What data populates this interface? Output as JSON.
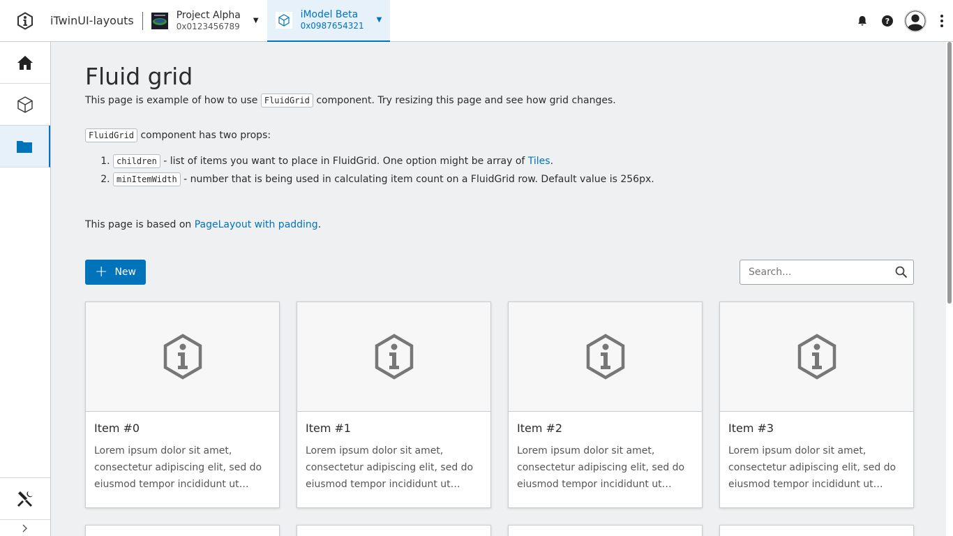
{
  "header": {
    "app_title": "iTwinUI-layouts",
    "project": {
      "name": "Project Alpha",
      "id": "0x0123456789"
    },
    "imodel": {
      "name": "iModel Beta",
      "id": "0x0987654321"
    },
    "icons": [
      "bell-icon",
      "help-icon",
      "user-icon",
      "more-vertical-icon"
    ]
  },
  "sidenav": {
    "items": [
      {
        "icon": "home-icon"
      },
      {
        "icon": "cube-icon"
      },
      {
        "icon": "folder-icon",
        "active": true
      }
    ],
    "bottom": {
      "icon": "settings-tools-icon"
    }
  },
  "page": {
    "title": "Fluid grid",
    "intro_before": "This page is example of how to use ",
    "intro_code": "FluidGrid",
    "intro_after": " component. Try resizing this page and see how grid changes.",
    "props_code": "FluidGrid",
    "props_text": " component has two props:",
    "prop1_code": "children",
    "prop1_text": " - list of items you want to place in FluidGrid. One option might be array of ",
    "prop1_link": "Tiles",
    "prop1_end": ".",
    "prop2_code": "minItemWidth",
    "prop2_text": " - number that is being used in calculating item count on a FluidGrid row. Default value is 256px.",
    "based_before": "This page is based on ",
    "based_link": "PageLayout with padding",
    "based_after": "."
  },
  "toolbar": {
    "new_label": "New",
    "search_placeholder": "Search..."
  },
  "tiles": [
    {
      "name": "Item #0",
      "description": "Lorem ipsum dolor sit amet, consectetur adipiscing elit, sed do eiusmod tempor incididunt ut labore et dolore magna aliqua."
    },
    {
      "name": "Item #1",
      "description": "Lorem ipsum dolor sit amet, consectetur adipiscing elit, sed do eiusmod tempor incididunt ut labore et dolore magna aliqua."
    },
    {
      "name": "Item #2",
      "description": "Lorem ipsum dolor sit amet, consectetur adipiscing elit, sed do eiusmod tempor incididunt ut labore et dolore magna aliqua."
    },
    {
      "name": "Item #3",
      "description": "Lorem ipsum dolor sit amet, consectetur adipiscing elit, sed do eiusmod tempor incididunt ut labore et dolore magna aliqua."
    }
  ],
  "colors": {
    "accent": "#0073ba",
    "background": "#eef0f1"
  }
}
